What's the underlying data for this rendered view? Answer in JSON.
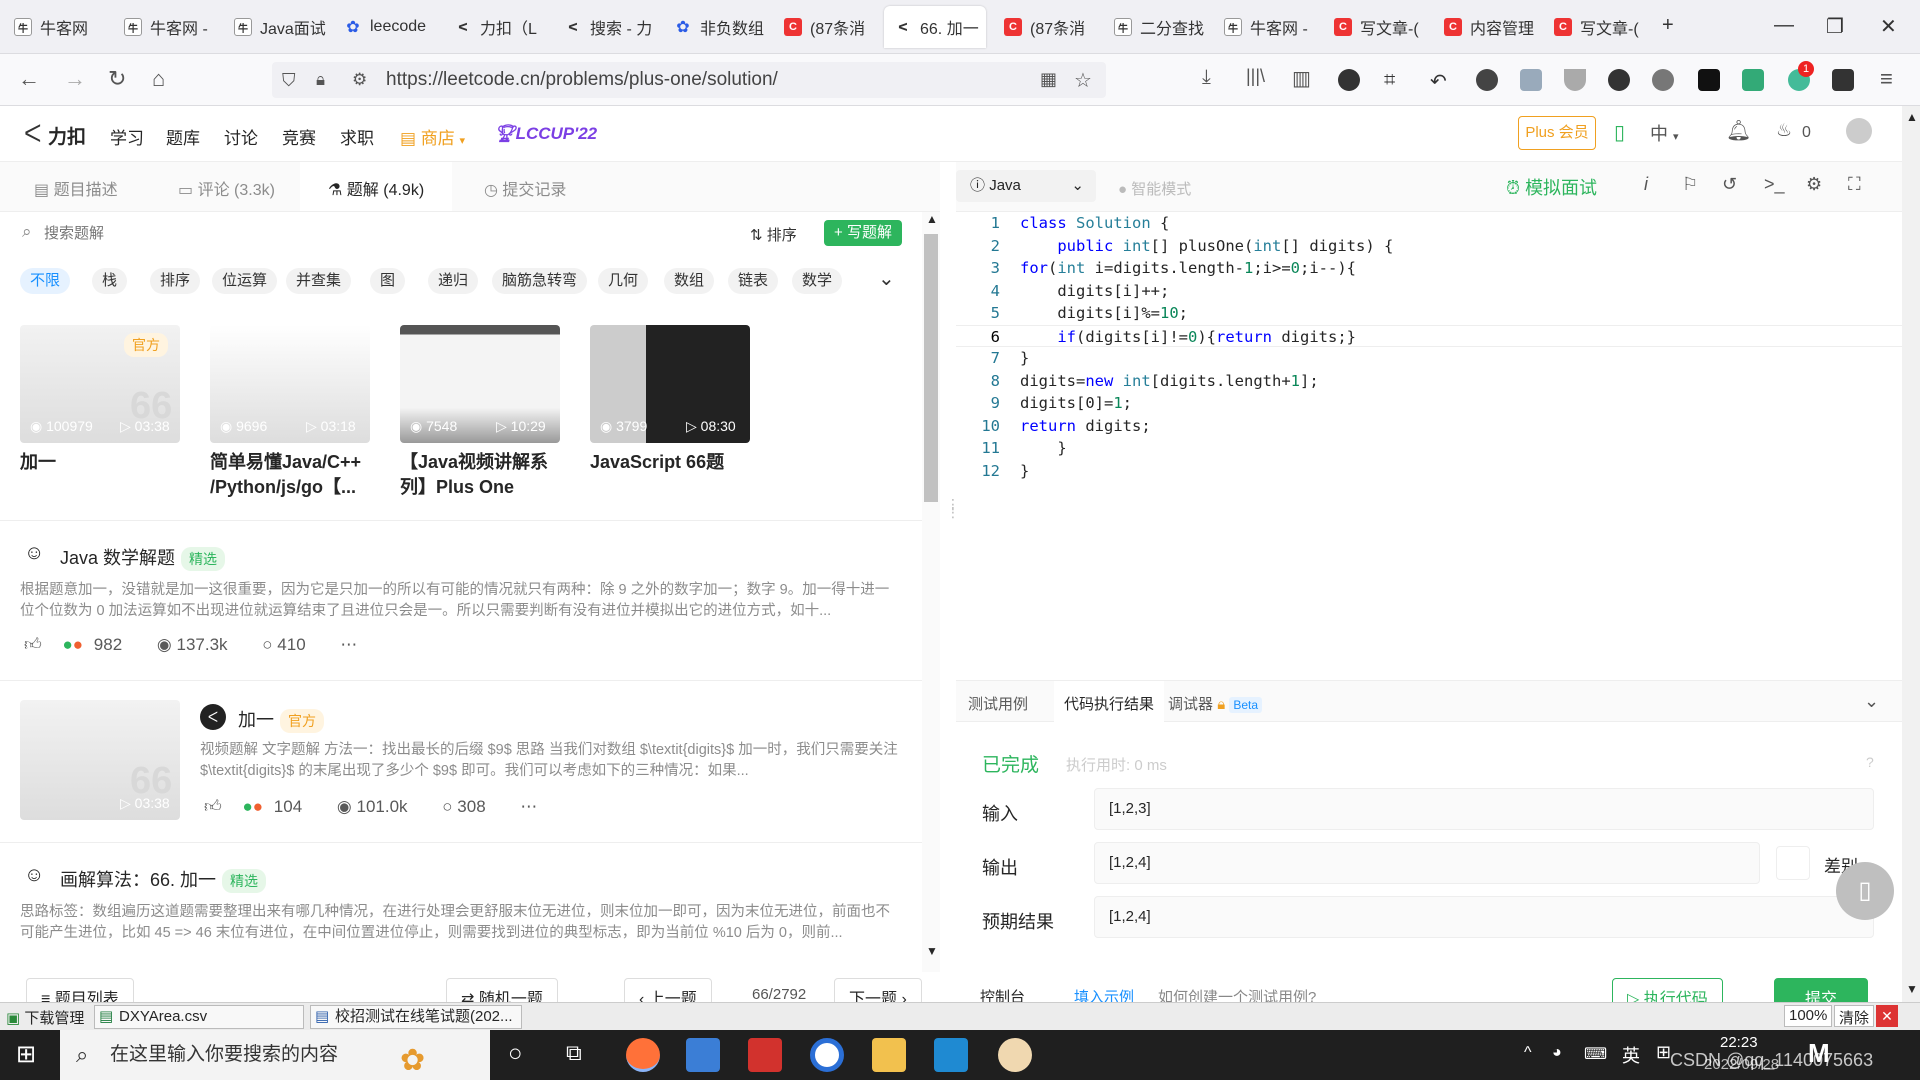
{
  "browser": {
    "tabs": [
      {
        "label": "牛客网",
        "icon": "nowcoder"
      },
      {
        "label": "牛客网 -",
        "icon": "nowcoder"
      },
      {
        "label": "Java面试",
        "icon": "nowcoder"
      },
      {
        "label": "leecode",
        "icon": "baidu"
      },
      {
        "label": "力扣（L",
        "icon": "leetcode"
      },
      {
        "label": "搜索 - 力",
        "icon": "leetcode"
      },
      {
        "label": "非负数组",
        "icon": "baidu"
      },
      {
        "label": "(87条消",
        "icon": "csdn"
      },
      {
        "label": "66. 加一",
        "icon": "leetcode",
        "active": true
      },
      {
        "label": "(87条消",
        "icon": "csdn"
      },
      {
        "label": "二分查找",
        "icon": "nowcoder"
      },
      {
        "label": "牛客网 -",
        "icon": "nowcoder"
      },
      {
        "label": "写文章-(",
        "icon": "csdn"
      },
      {
        "label": "内容管理",
        "icon": "csdn"
      },
      {
        "label": "写文章-(",
        "icon": "csdn"
      }
    ],
    "url": "https://leetcode.cn/problems/plus-one/solution/",
    "ext_badge": "1"
  },
  "header": {
    "logo": "力扣",
    "nav": [
      "学习",
      "题库",
      "讨论",
      "竞赛",
      "求职"
    ],
    "store": "商店",
    "lccup": "LCCUP'22",
    "plus": "Plus 会员",
    "lang": "中",
    "streak": "0"
  },
  "left": {
    "tabs": [
      "题目描述",
      "评论 (3.3k)",
      "题解 (4.9k)",
      "提交记录"
    ],
    "search_placeholder": "搜索题解",
    "sort": "排序",
    "write": "写题解",
    "chips": [
      "不限",
      "栈",
      "排序",
      "位运算",
      "并查集",
      "图",
      "递归",
      "脑筋急转弯",
      "几何",
      "数组",
      "链表",
      "数学"
    ],
    "videos": [
      {
        "title": "加一",
        "views": "100979",
        "duration": "03:38",
        "tag": "官方"
      },
      {
        "title": "简单易懂Java/C++ /Python/js/go【...",
        "views": "9696",
        "duration": "03:18"
      },
      {
        "title": "【Java视频讲解系列】Plus One",
        "views": "7548",
        "duration": "10:29"
      },
      {
        "title": "JavaScript 66题",
        "views": "3799",
        "duration": "08:30"
      }
    ],
    "posts": [
      {
        "title": "Java 数学解题",
        "badge": "精选",
        "desc": "根据题意加一，没错就是加一这很重要，因为它是只加一的所以有可能的情况就只有两种：除 9 之外的数字加一；数字 9。加一得十进一位个位数为 0 加法运算如不出现进位就运算结束了且进位只会是一。所以只需要判断有没有进位并模拟出它的进位方式，如十...",
        "likes": "982",
        "views": "137.3k",
        "comments": "410"
      },
      {
        "title": "加一",
        "badge": "官方",
        "desc": "视频题解  文字题解 方法一：找出最长的后缀 $9$ 思路 当我们对数组 $\\textit{digits}$ 加一时，我们只需要关注 $\\textit{digits}$ 的末尾出现了多少个 $9$ 即可。我们可以考虑如下的三种情况：如果...",
        "likes": "104",
        "views": "101.0k",
        "comments": "308",
        "duration": "03:38"
      },
      {
        "title": "画解算法：66. 加一",
        "badge": "精选",
        "desc": "思路标签：数组遍历这道题需要整理出来有哪几种情况，在进行处理会更舒服末位无进位，则末位加一即可，因为末位无进位，前面也不可能产生进位，比如 45 => 46 末位有进位，在中间位置进位停止，则需要找到进位的典型标志，即为当前位 %10 后为 0，则前..."
      }
    ]
  },
  "editor": {
    "language": "Java",
    "smart_mode": "智能模式",
    "mock_interview": "模拟面试",
    "code": [
      "class Solution {",
      "    public int[] plusOne(int[] digits) {",
      "for(int i=digits.length-1;i>=0;i--){",
      "    digits[i]++;",
      "    digits[i]%=10;",
      "    if(digits[i]!=0){return digits;}",
      "}",
      "digits=new int[digits.length+1];",
      "digits[0]=1;",
      "return digits;",
      "    }",
      "}"
    ]
  },
  "result": {
    "tabs": [
      "测试用例",
      "代码执行结果",
      "调试器",
      "Beta"
    ],
    "status": "已完成",
    "exec_time": "执行用时: 0 ms",
    "input_label": "输入",
    "input": "[1,2,3]",
    "output_label": "输出",
    "output": "[1,2,4]",
    "expected_label": "预期结果",
    "expected": "[1,2,4]",
    "diff": "差别"
  },
  "bottom": {
    "problem_list": "题目列表",
    "random": "随机一题",
    "prev": "上一题",
    "page": "66/2792",
    "next": "下一题",
    "console": "控制台",
    "fill_example": "填入示例",
    "how_create": "如何创建一个测试用例?",
    "run": "执行代码",
    "submit": "提交"
  },
  "downloads": {
    "label": "下载管理",
    "items": [
      "DXYArea.csv",
      "校招测试在线笔试题(202..."
    ],
    "zoom": "100%",
    "clear": "清除"
  },
  "taskbar": {
    "search": "在这里输入你要搜索的内容",
    "ime": "英",
    "time": "22:23",
    "date": "2022/09/28",
    "watermark": "CSDN @qq_1140075663"
  }
}
